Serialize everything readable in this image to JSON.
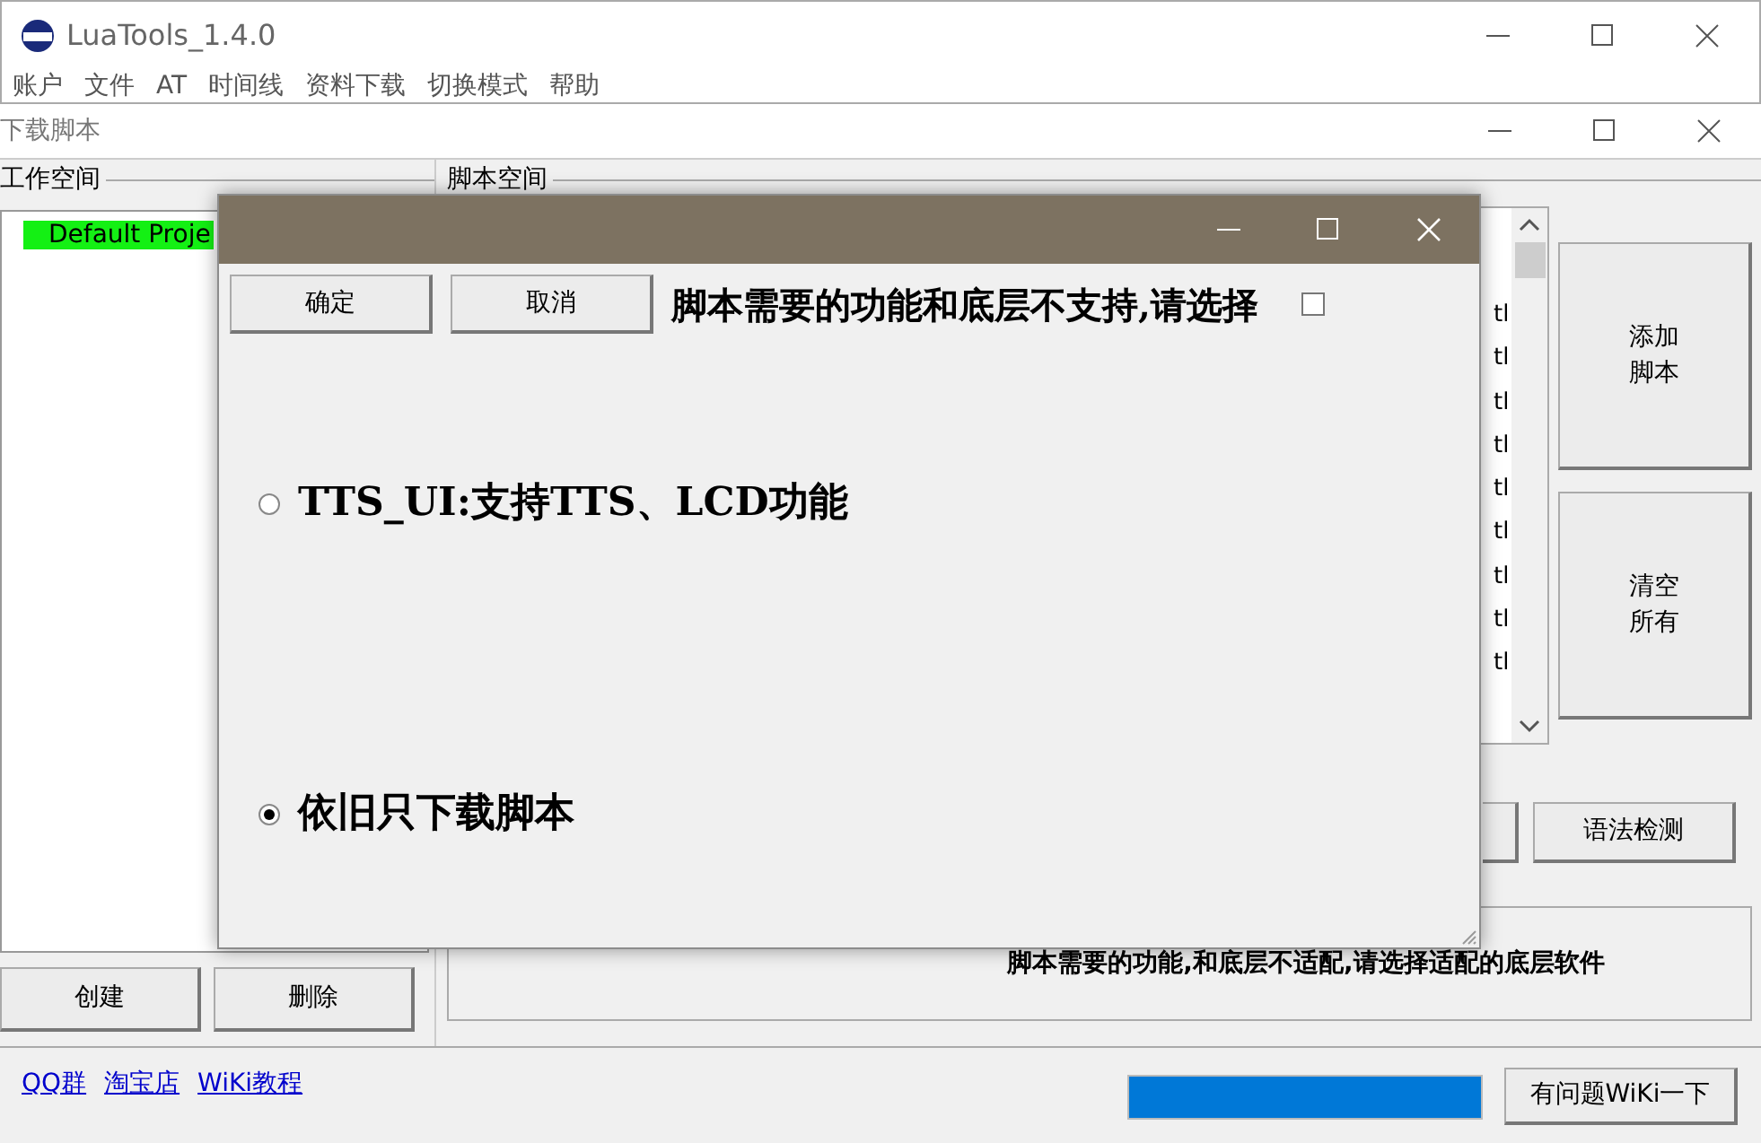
{
  "main_window": {
    "title": "LuaTools_1.4.0",
    "menu": [
      "账户",
      "文件",
      "AT",
      "时间线",
      "资料下载",
      "切换模式",
      "帮助"
    ]
  },
  "download_window": {
    "title": "下载脚本",
    "workspace": {
      "label": "工作空间",
      "projects": [
        {
          "label": "Default Proje",
          "selected": true
        }
      ],
      "buttons": [
        "创建",
        "删除"
      ]
    },
    "script_space": {
      "label": "脚本空间",
      "files": [
        "tl",
        "tl",
        "tl",
        "tl",
        "tl",
        "tl",
        "tl",
        "tl",
        "tl"
      ],
      "side_buttons": [
        [
          "添加",
          "脚本"
        ],
        [
          "清空",
          "所有"
        ]
      ],
      "check_button": "语法检测",
      "status": "脚本需要的功能,和底层不适配,请选择适配的底层软件"
    },
    "footer": {
      "links": [
        "QQ群",
        "淘宝店",
        "WiKi教程"
      ],
      "progress": {
        "level": 1
      },
      "help_button": "有问题WiKi一下"
    }
  },
  "dialog": {
    "buttons": [
      "确定",
      "取消"
    ],
    "message": "脚本需要的功能和底层不支持,请选择",
    "remember_checked": false,
    "options": [
      {
        "label": "TTS_UI:支持TTS、LCD功能",
        "selected": false
      },
      {
        "label": "依旧只下载脚本",
        "selected": true
      }
    ]
  }
}
